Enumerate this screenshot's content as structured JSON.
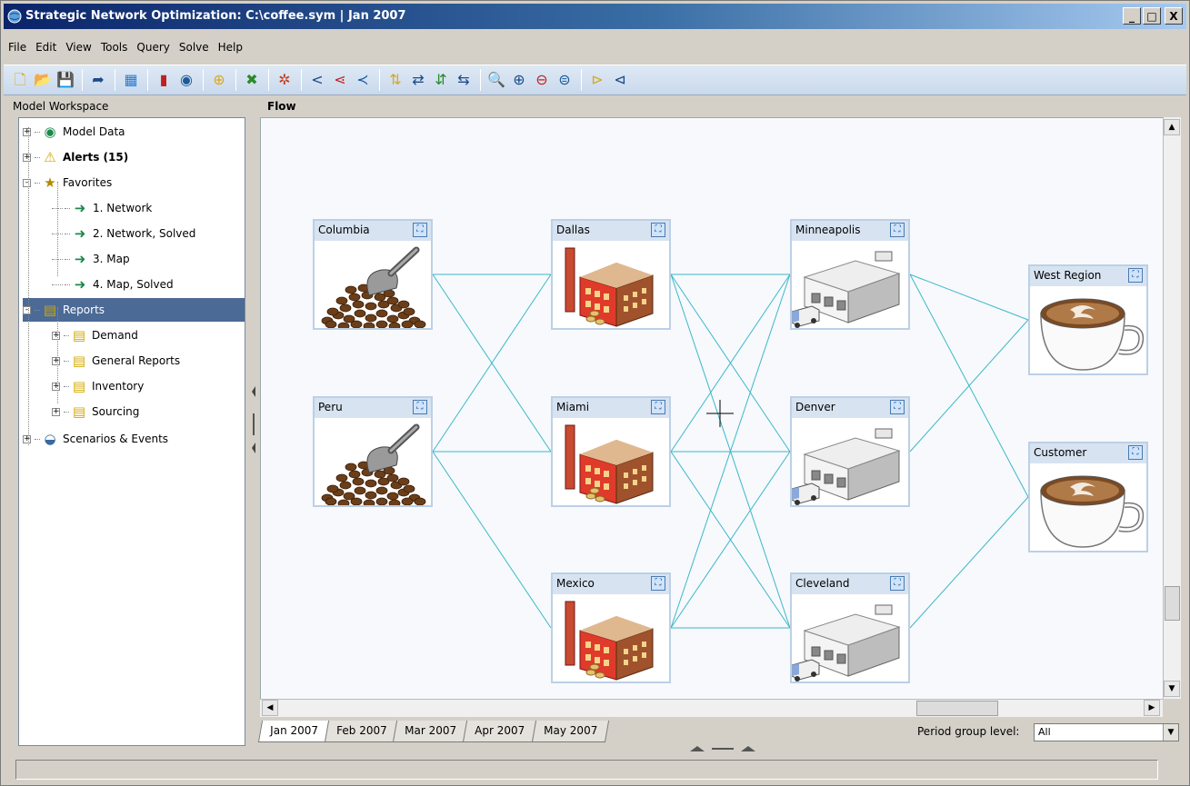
{
  "window": {
    "title": "Strategic Network Optimization:  C:\\coffee.sym | Jan 2007",
    "controls": [
      "_",
      "□",
      "X"
    ]
  },
  "menu": [
    {
      "label": "File",
      "name": "menu-file"
    },
    {
      "label": "Edit",
      "name": "menu-edit"
    },
    {
      "label": "View",
      "name": "menu-view"
    },
    {
      "label": "Tools",
      "name": "menu-tools"
    },
    {
      "label": "Query",
      "name": "menu-query"
    },
    {
      "label": "Solve",
      "name": "menu-solve"
    },
    {
      "label": "Help",
      "name": "menu-help"
    }
  ],
  "toolbar": [
    {
      "icon": "new-file-icon",
      "glyph": "🗋"
    },
    {
      "icon": "open-folder-icon",
      "glyph": "📂"
    },
    {
      "icon": "save-icon",
      "glyph": "💾"
    },
    {
      "sep": true
    },
    {
      "icon": "export-icon",
      "glyph": "➦"
    },
    {
      "sep": true
    },
    {
      "icon": "calculator-icon",
      "glyph": "▦"
    },
    {
      "sep": true
    },
    {
      "icon": "bar-chart-icon",
      "glyph": "▮"
    },
    {
      "icon": "globe-icon",
      "glyph": "◉"
    },
    {
      "sep": true
    },
    {
      "icon": "binoculars-icon",
      "glyph": "⊕"
    },
    {
      "sep": true
    },
    {
      "icon": "delete-window-icon",
      "glyph": "✖"
    },
    {
      "sep": true
    },
    {
      "icon": "network-icon",
      "glyph": "✲"
    },
    {
      "sep": true
    },
    {
      "icon": "branch-left-icon",
      "glyph": "<"
    },
    {
      "icon": "branch-dots-icon",
      "glyph": "⋖"
    },
    {
      "icon": "branch-merge-icon",
      "glyph": "≺"
    },
    {
      "sep": true
    },
    {
      "icon": "sort-vertical-icon",
      "glyph": "⇅"
    },
    {
      "icon": "sort-horizontal-icon",
      "glyph": "⇄"
    },
    {
      "icon": "sort-az-icon",
      "glyph": "⇵"
    },
    {
      "icon": "sort-za-icon",
      "glyph": "⇆"
    },
    {
      "sep": true
    },
    {
      "icon": "zoom-icon",
      "glyph": "🔍"
    },
    {
      "icon": "zoom-in-icon",
      "glyph": "⊕"
    },
    {
      "icon": "zoom-out-icon",
      "glyph": "⊖"
    },
    {
      "icon": "zoom-fit-icon",
      "glyph": "⊜"
    },
    {
      "sep": true
    },
    {
      "icon": "layout-left-icon",
      "glyph": "⊳"
    },
    {
      "icon": "layout-right-icon",
      "glyph": "⊲"
    }
  ],
  "left_pane": {
    "header": "Model Workspace",
    "tree": [
      {
        "label": "Model Data",
        "icon": "globe-icon",
        "glyph": "◉",
        "color": "#1a8a4a",
        "level": 0,
        "expander": "+",
        "bold": false
      },
      {
        "label": "Alerts (15)",
        "icon": "warning-icon",
        "glyph": "⚠",
        "color": "#d4a800",
        "level": 0,
        "expander": "+",
        "bold": true
      },
      {
        "label": "Favorites",
        "icon": "favorites-folder-icon",
        "glyph": "★",
        "color": "#b08a00",
        "level": 0,
        "expander": "−",
        "bold": false
      },
      {
        "label": "1. Network",
        "icon": "favorite-link-icon",
        "glyph": "➜",
        "color": "#1a8a4a",
        "level": 1,
        "expander": "",
        "bold": false
      },
      {
        "label": "2. Network, Solved",
        "icon": "favorite-link-icon",
        "glyph": "➜",
        "color": "#1a8a4a",
        "level": 1,
        "expander": "",
        "bold": false
      },
      {
        "label": "3. Map",
        "icon": "favorite-link-icon",
        "glyph": "➜",
        "color": "#1a8a4a",
        "level": 1,
        "expander": "",
        "bold": false
      },
      {
        "label": "4. Map, Solved",
        "icon": "favorite-link-icon",
        "glyph": "➜",
        "color": "#1a8a4a",
        "level": 1,
        "expander": "",
        "bold": false
      },
      {
        "label": "Reports",
        "icon": "reports-folder-icon",
        "glyph": "▤",
        "color": "#d4a800",
        "level": 0,
        "expander": "−",
        "bold": false,
        "selected": true
      },
      {
        "label": "Demand",
        "icon": "report-folder-icon",
        "glyph": "▤",
        "color": "#d4a800",
        "level": 1,
        "expander": "+",
        "bold": false
      },
      {
        "label": "General Reports",
        "icon": "report-folder-icon",
        "glyph": "▤",
        "color": "#d4a800",
        "level": 1,
        "expander": "+",
        "bold": false
      },
      {
        "label": "Inventory",
        "icon": "report-folder-icon",
        "glyph": "▤",
        "color": "#d4a800",
        "level": 1,
        "expander": "+",
        "bold": false
      },
      {
        "label": "Sourcing",
        "icon": "report-folder-icon",
        "glyph": "▤",
        "color": "#d4a800",
        "level": 1,
        "expander": "+",
        "bold": false
      },
      {
        "label": "Scenarios & Events",
        "icon": "scenarios-icon",
        "glyph": "◒",
        "color": "#3a6aa0",
        "level": 0,
        "expander": "+",
        "bold": false
      }
    ]
  },
  "flow": {
    "header": "Flow",
    "nodes": [
      {
        "id": "columbia",
        "label": "Columbia",
        "kind": "coffee-beans"
      },
      {
        "id": "peru",
        "label": "Peru",
        "kind": "coffee-beans"
      },
      {
        "id": "dallas",
        "label": "Dallas",
        "kind": "factory"
      },
      {
        "id": "miami",
        "label": "Miami",
        "kind": "factory"
      },
      {
        "id": "mexico",
        "label": "Mexico",
        "kind": "factory"
      },
      {
        "id": "minneapolis",
        "label": "Minneapolis",
        "kind": "warehouse"
      },
      {
        "id": "denver",
        "label": "Denver",
        "kind": "warehouse"
      },
      {
        "id": "cleveland",
        "label": "Cleveland",
        "kind": "warehouse"
      },
      {
        "id": "west_region",
        "label": "West Region",
        "kind": "coffee-cup"
      },
      {
        "id": "customer",
        "label": "Customer",
        "kind": "coffee-cup"
      }
    ],
    "links": [
      [
        "columbia",
        "dallas"
      ],
      [
        "columbia",
        "miami"
      ],
      [
        "peru",
        "dallas"
      ],
      [
        "peru",
        "miami"
      ],
      [
        "peru",
        "mexico"
      ],
      [
        "dallas",
        "minneapolis"
      ],
      [
        "dallas",
        "denver"
      ],
      [
        "dallas",
        "cleveland"
      ],
      [
        "miami",
        "minneapolis"
      ],
      [
        "miami",
        "denver"
      ],
      [
        "miami",
        "cleveland"
      ],
      [
        "mexico",
        "minneapolis"
      ],
      [
        "mexico",
        "denver"
      ],
      [
        "mexico",
        "cleveland"
      ],
      [
        "minneapolis",
        "west_region"
      ],
      [
        "minneapolis",
        "customer"
      ],
      [
        "denver",
        "west_region"
      ],
      [
        "cleveland",
        "customer"
      ]
    ],
    "link_color": "#3ab8c8"
  },
  "period_tabs": [
    "Jan 2007",
    "Feb 2007",
    "Mar 2007",
    "Apr 2007",
    "May 2007"
  ],
  "active_tab": "Jan 2007",
  "period_group": {
    "label": "Period group level:",
    "value": "All"
  },
  "status": {
    "text": ""
  }
}
